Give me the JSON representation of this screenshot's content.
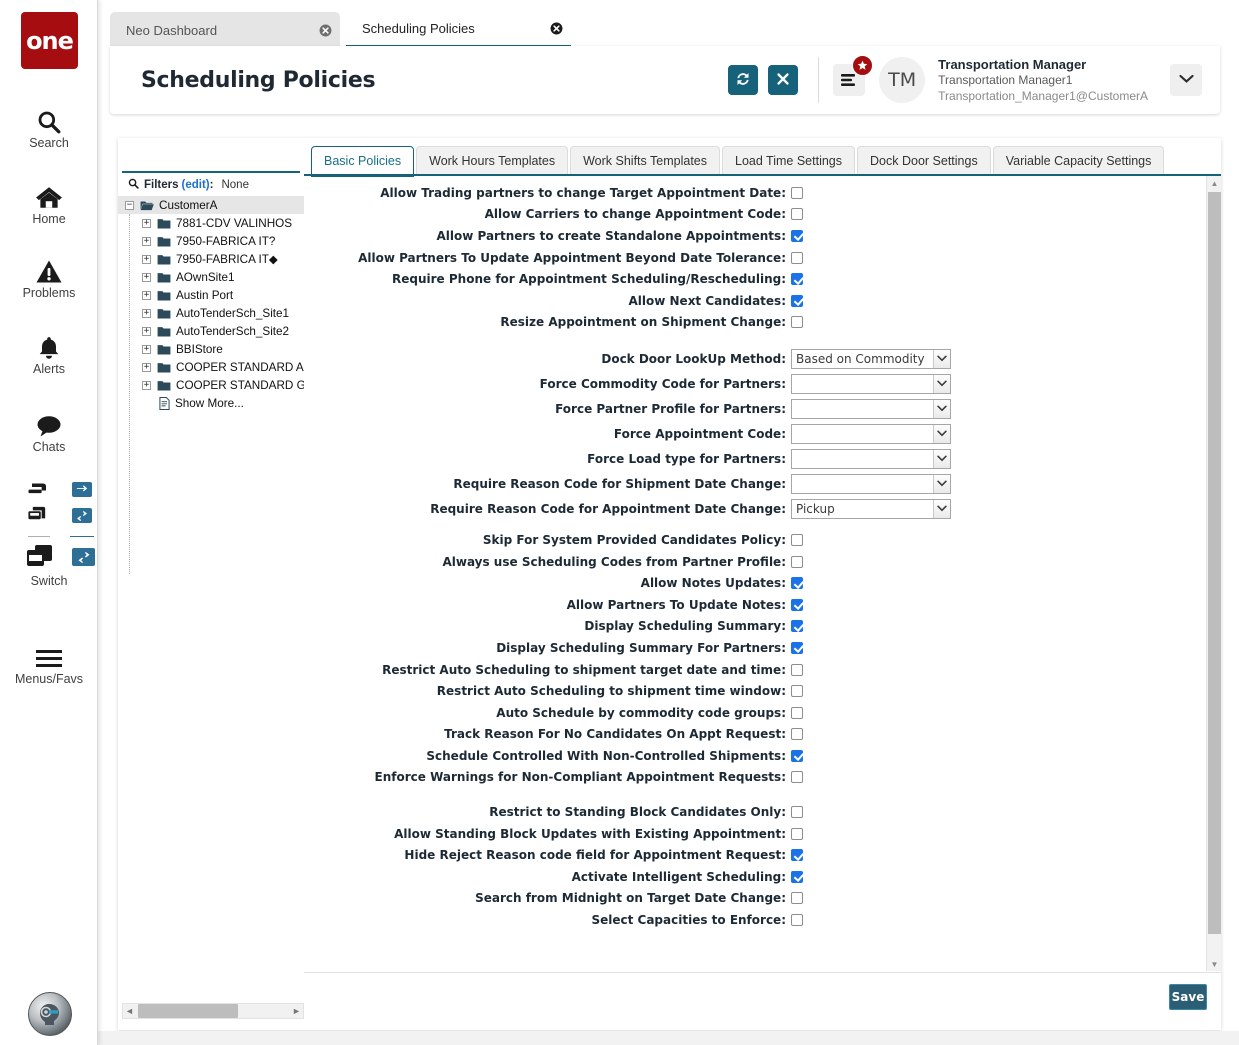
{
  "app": {
    "logo_text": "one",
    "brand_color": "#a50d10",
    "accent_color": "#16627a"
  },
  "rail": {
    "items": [
      {
        "label": "Search",
        "icon": "search-icon"
      },
      {
        "label": "Home",
        "icon": "home-icon"
      },
      {
        "label": "Problems",
        "icon": "warning-triangle-icon"
      },
      {
        "label": "Alerts",
        "icon": "bell-icon"
      },
      {
        "label": "Chats",
        "icon": "chat-bubble-icon"
      },
      {
        "label": "Switch",
        "icon": "switch-windows-icon"
      },
      {
        "label": "Menus/Favs",
        "icon": "hamburger-icon"
      }
    ],
    "assistant_icon": "ai-assistant-avatar-icon"
  },
  "browser_tabs": [
    {
      "label": "Neo Dashboard",
      "active": false,
      "close_icon": "close-circle-icon"
    },
    {
      "label": "Scheduling Policies",
      "active": true,
      "close_icon": "close-circle-icon"
    }
  ],
  "header": {
    "title": "Scheduling Policies",
    "refresh_icon": "refresh-icon",
    "close_icon": "x-icon",
    "menu_icon": "list-menu-icon",
    "badge_icon": "star-badge-icon",
    "avatar_initials": "TM",
    "user_role": "Transportation Manager",
    "user_name": "Transportation Manager1",
    "user_email": "Transportation_Manager1@CustomerA",
    "chevron_icon": "chevron-down-icon"
  },
  "tree_panel": {
    "filters_icon": "search-icon",
    "filters_label": "Filters",
    "filters_edit": "(edit)",
    "filters_value": "None",
    "root": {
      "label": "CustomerA",
      "toggle": "minus",
      "icon": "folder-open-icon"
    },
    "nodes": [
      {
        "label": "7881-CDV VALINHOS",
        "toggle": "plus",
        "icon": "folder-icon"
      },
      {
        "label": "7950-FABRICA IT?",
        "toggle": "plus",
        "icon": "folder-icon"
      },
      {
        "label": "7950-FABRICA IT◆",
        "toggle": "plus",
        "icon": "folder-icon"
      },
      {
        "label": "AOwnSite1",
        "toggle": "plus",
        "icon": "folder-icon"
      },
      {
        "label": "Austin Port",
        "toggle": "plus",
        "icon": "folder-icon"
      },
      {
        "label": "AutoTenderSch_Site1",
        "toggle": "plus",
        "icon": "folder-icon"
      },
      {
        "label": "AutoTenderSch_Site2",
        "toggle": "plus",
        "icon": "folder-icon"
      },
      {
        "label": "BBIStore",
        "toggle": "plus",
        "icon": "folder-icon"
      },
      {
        "label": "COOPER STANDARD AGUA",
        "toggle": "plus",
        "icon": "folder-icon"
      },
      {
        "label": "COOPER STANDARD GOLD",
        "toggle": "plus",
        "icon": "folder-icon"
      }
    ],
    "show_more": {
      "label": "Show More...",
      "icon": "document-icon"
    },
    "hscroll": {
      "left_arrow": "◄",
      "right_arrow": "►"
    }
  },
  "form_tabs": [
    {
      "label": "Basic Policies",
      "active": true
    },
    {
      "label": "Work Hours Templates",
      "active": false
    },
    {
      "label": "Work Shifts Templates",
      "active": false
    },
    {
      "label": "Load Time Settings",
      "active": false
    },
    {
      "label": "Dock Door Settings",
      "active": false
    },
    {
      "label": "Variable Capacity Settings",
      "active": false
    }
  ],
  "form": {
    "group1": [
      {
        "label": "Allow Trading partners to change Target Appointment Date:",
        "checked": false
      },
      {
        "label": "Allow Carriers to change Appointment Code:",
        "checked": false
      },
      {
        "label": "Allow Partners to create Standalone Appointments:",
        "checked": true
      },
      {
        "label": "Allow Partners To Update Appointment Beyond Date Tolerance:",
        "checked": false
      },
      {
        "label": "Require Phone for Appointment Scheduling/Rescheduling:",
        "checked": true
      },
      {
        "label": "Allow Next Candidates:",
        "checked": true
      },
      {
        "label": "Resize Appointment on Shipment Change:",
        "checked": false
      }
    ],
    "selects": [
      {
        "label": "Dock Door LookUp Method:",
        "value": "Based on Commodity"
      },
      {
        "label": "Force Commodity Code for Partners:",
        "value": ""
      },
      {
        "label": "Force Partner Profile for Partners:",
        "value": ""
      },
      {
        "label": "Force Appointment Code:",
        "value": ""
      },
      {
        "label": "Force Load type for Partners:",
        "value": ""
      },
      {
        "label": "Require Reason Code for Shipment Date Change:",
        "value": ""
      },
      {
        "label": "Require Reason Code for Appointment Date Change:",
        "value": "Pickup"
      }
    ],
    "group2": [
      {
        "label": "Skip For System Provided Candidates Policy:",
        "checked": false
      },
      {
        "label": "Always use Scheduling Codes from Partner Profile:",
        "checked": false
      },
      {
        "label": "Allow Notes Updates:",
        "checked": true
      },
      {
        "label": "Allow Partners To Update Notes:",
        "checked": true
      },
      {
        "label": "Display Scheduling Summary:",
        "checked": true
      },
      {
        "label": "Display Scheduling Summary For Partners:",
        "checked": true
      },
      {
        "label": "Restrict Auto Scheduling to shipment target date and time:",
        "checked": false
      },
      {
        "label": "Restrict Auto Scheduling to shipment time window:",
        "checked": false
      },
      {
        "label": "Auto Schedule by commodity code groups:",
        "checked": false
      },
      {
        "label": "Track Reason For No Candidates On Appt Request:",
        "checked": false
      },
      {
        "label": "Schedule Controlled With Non-Controlled Shipments:",
        "checked": true
      },
      {
        "label": "Enforce Warnings for Non-Compliant Appointment Requests:",
        "checked": false
      }
    ],
    "group3": [
      {
        "label": "Restrict to Standing Block Candidates Only:",
        "checked": false
      },
      {
        "label": "Allow Standing Block Updates with Existing Appointment:",
        "checked": false
      },
      {
        "label": "Hide Reject Reason code field for Appointment Request:",
        "checked": true
      },
      {
        "label": "Activate Intelligent Scheduling:",
        "checked": true
      },
      {
        "label": "Search from Midnight on Target Date Change:",
        "checked": false
      },
      {
        "label": "Select Capacities to Enforce:",
        "checked": false
      }
    ],
    "save_label": "Save",
    "vscroll": {
      "up_arrow": "▲",
      "down_arrow": "▼"
    }
  }
}
